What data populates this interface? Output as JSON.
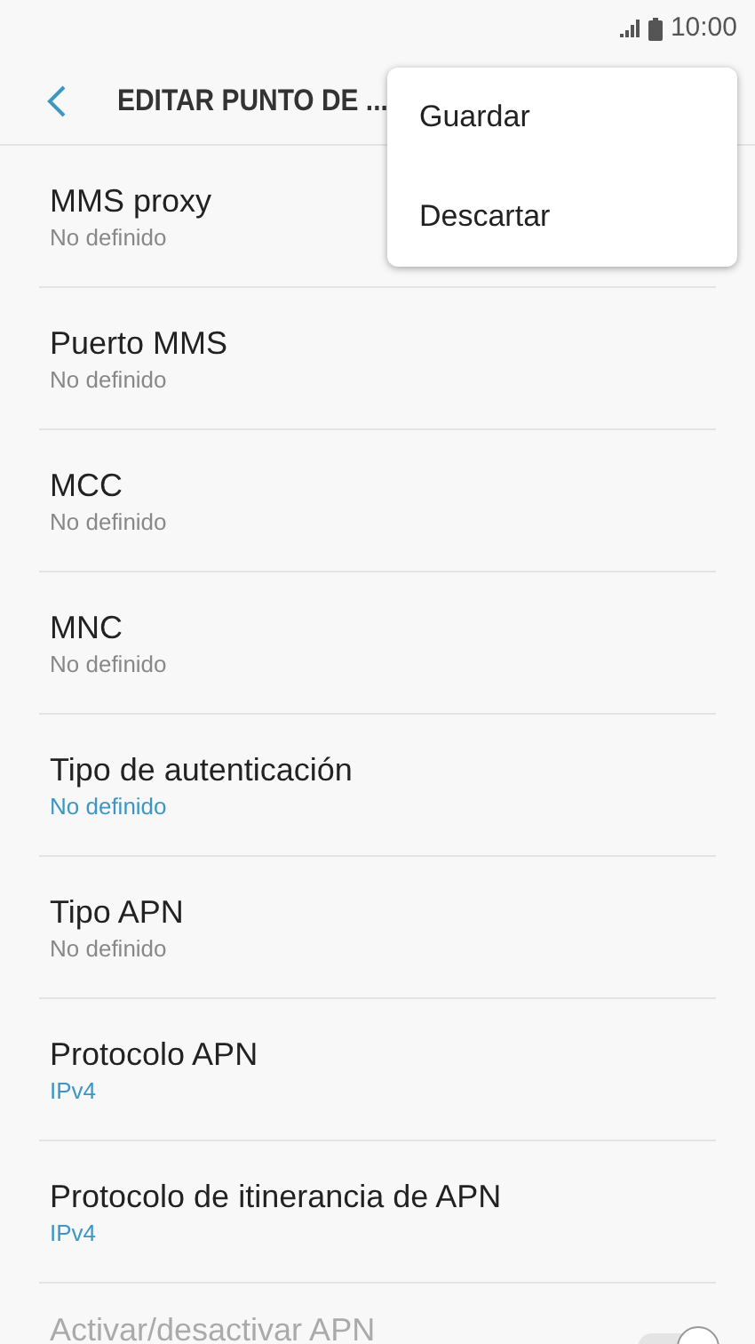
{
  "status_bar": {
    "time": "10:00"
  },
  "header": {
    "title": "EDITAR PUNTO DE ..."
  },
  "menu": [
    {
      "label": "Guardar"
    },
    {
      "label": "Descartar"
    }
  ],
  "settings": [
    {
      "kind": "text",
      "title": "MMS proxy",
      "value": "No definido"
    },
    {
      "kind": "text",
      "title": "Puerto MMS",
      "value": "No definido"
    },
    {
      "kind": "text",
      "title": "MCC",
      "value": "No definido"
    },
    {
      "kind": "text",
      "title": "MNC",
      "value": "No definido"
    },
    {
      "kind": "list",
      "title": "Tipo de autenticación",
      "value": "No definido"
    },
    {
      "kind": "text",
      "title": "Tipo APN",
      "value": "No definido"
    },
    {
      "kind": "list",
      "title": "Protocolo APN",
      "value": "IPv4"
    },
    {
      "kind": "list",
      "title": "Protocolo de itinerancia de APN",
      "value": "IPv4"
    },
    {
      "kind": "switch",
      "title": "Activar/desactivar APN",
      "disabled": true,
      "on": true
    }
  ]
}
